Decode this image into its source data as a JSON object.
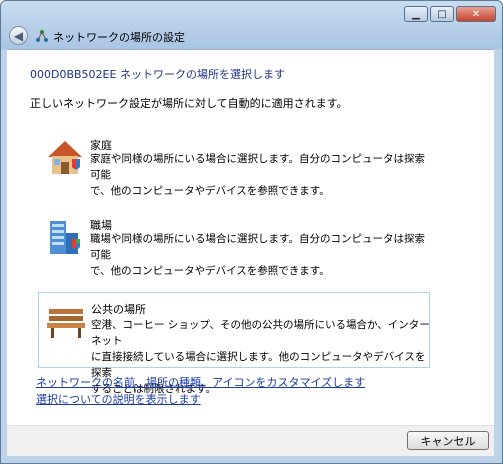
{
  "window": {
    "title": "ネットワークの場所の設定",
    "minimize": "▁",
    "maximize": "□",
    "close": "✕"
  },
  "heading": "000D0BB502EE ネットワークの場所を選択します",
  "intro": "正しいネットワーク設定が場所に対して自動的に適用されます。",
  "options": [
    {
      "title": "家庭",
      "desc": "家庭や同様の場所にいる場合に選択します。自分のコンピュータは探索可能\nで、他のコンピュータやデバイスを参照できます。"
    },
    {
      "title": "職場",
      "desc": "職場や同様の場所にいる場合に選択します。自分のコンピュータは探索可能\nで、他のコンピュータやデバイスを参照できます。"
    },
    {
      "title": "公共の場所",
      "desc": "空港、コーヒー ショップ、その他の公共の場所にいる場合か、インターネット\nに直接接続している場合に選択します。他のコンピュータやデバイスを探索\nすることは制限されます。"
    }
  ],
  "links": {
    "customize": "ネットワークの名前、場所の種類、アイコンをカスタマイズします",
    "explain": "選択についての説明を表示します"
  },
  "buttons": {
    "cancel": "キャンセル"
  }
}
